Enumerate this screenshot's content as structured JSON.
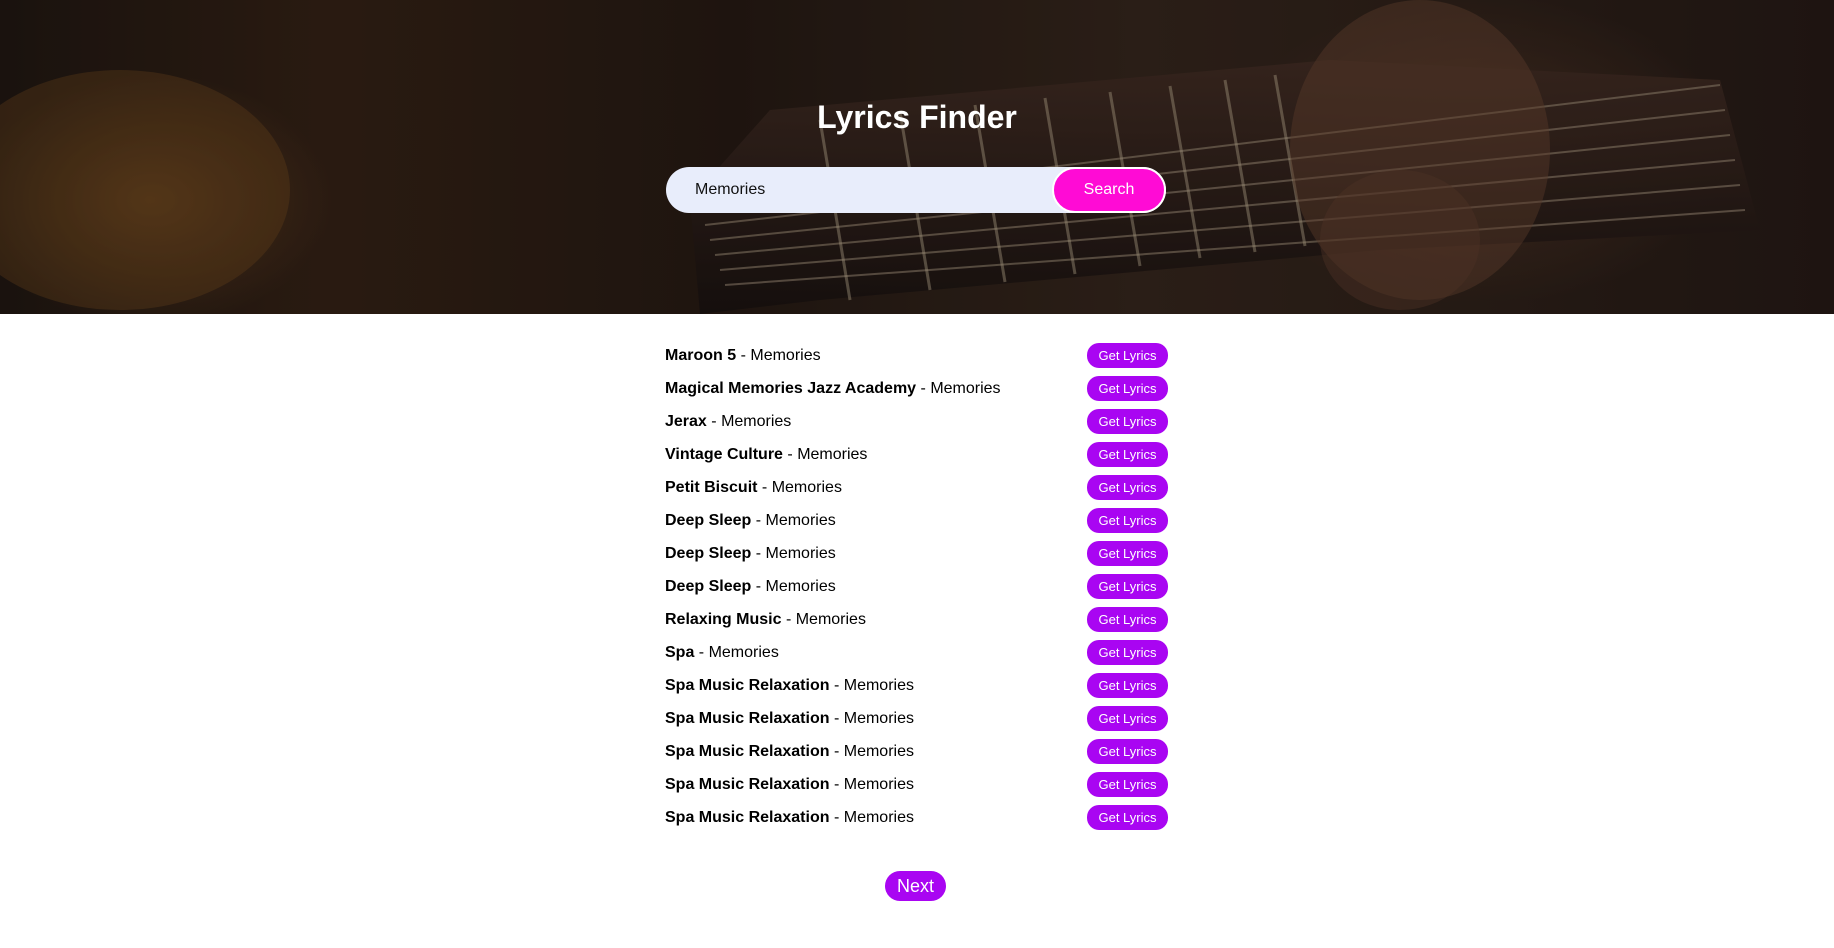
{
  "header": {
    "title": "Lyrics Finder",
    "hero_image": "guitar-fretboard-background"
  },
  "search": {
    "value": "Memories",
    "placeholder": "",
    "button_label": "Search"
  },
  "results": {
    "separator": "-",
    "button_label": "Get Lyrics",
    "items": [
      {
        "artist": "Maroon 5",
        "title": "Memories"
      },
      {
        "artist": "Magical Memories Jazz Academy",
        "title": "Memories"
      },
      {
        "artist": "Jerax",
        "title": "Memories"
      },
      {
        "artist": "Vintage Culture",
        "title": "Memories"
      },
      {
        "artist": "Petit Biscuit",
        "title": "Memories"
      },
      {
        "artist": "Deep Sleep",
        "title": "Memories"
      },
      {
        "artist": "Deep Sleep",
        "title": "Memories"
      },
      {
        "artist": "Deep Sleep",
        "title": "Memories"
      },
      {
        "artist": "Relaxing Music",
        "title": "Memories"
      },
      {
        "artist": "Spa",
        "title": "Memories"
      },
      {
        "artist": "Spa Music Relaxation",
        "title": "Memories"
      },
      {
        "artist": "Spa Music Relaxation",
        "title": "Memories"
      },
      {
        "artist": "Spa Music Relaxation",
        "title": "Memories"
      },
      {
        "artist": "Spa Music Relaxation",
        "title": "Memories"
      },
      {
        "artist": "Spa Music Relaxation",
        "title": "Memories"
      }
    ]
  },
  "pagination": {
    "next_label": "Next"
  },
  "colors": {
    "search_button": "#ff0bd5",
    "accent_purple": "#a905f2",
    "search_field_bg": "#e8edfb"
  }
}
